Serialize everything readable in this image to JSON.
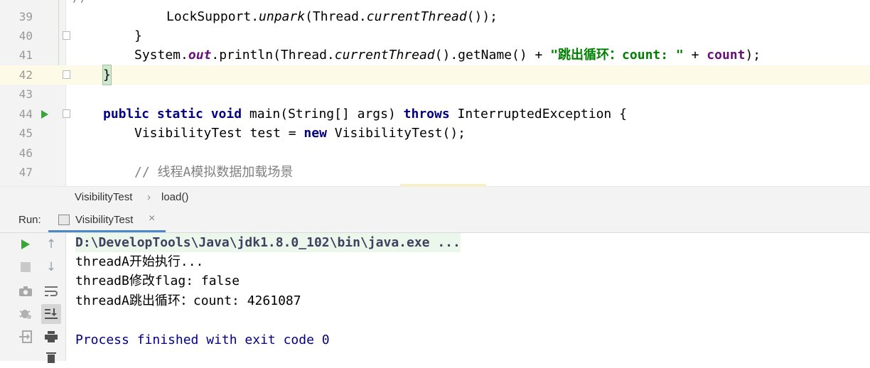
{
  "editor": {
    "lines": [
      {
        "num": "39",
        "segments": [
          {
            "t": "LockSupport.",
            "c": ""
          },
          {
            "t": "unpark",
            "c": "it"
          },
          {
            "t": "(Thread.",
            "c": ""
          },
          {
            "t": "currentThread",
            "c": "it"
          },
          {
            "t": "());",
            "c": ""
          }
        ]
      },
      {
        "num": "40",
        "segments": [
          {
            "t": "}",
            "c": ""
          }
        ]
      },
      {
        "num": "41",
        "segments": [
          {
            "t": "System.",
            "c": ""
          },
          {
            "t": "out",
            "c": "fld"
          },
          {
            "t": ".println(Thread.",
            "c": ""
          },
          {
            "t": "currentThread",
            "c": "it"
          },
          {
            "t": "().getName() + ",
            "c": ""
          },
          {
            "t": "\"跳出循环：count: \"",
            "c": "str"
          },
          {
            "t": " + ",
            "c": ""
          },
          {
            "t": "count",
            "c": "var"
          },
          {
            "t": ");",
            "c": ""
          }
        ]
      },
      {
        "num": "42",
        "segments": [
          {
            "t": "}",
            "c": ""
          }
        ]
      },
      {
        "num": "43",
        "segments": []
      },
      {
        "num": "44",
        "segments": [
          {
            "t": "public static void",
            "c": "kw"
          },
          {
            "t": " main(String[] args) ",
            "c": ""
          },
          {
            "t": "throws",
            "c": "kw"
          },
          {
            "t": " InterruptedException {",
            "c": ""
          }
        ]
      },
      {
        "num": "45",
        "segments": [
          {
            "t": "VisibilityTest test = ",
            "c": ""
          },
          {
            "t": "new",
            "c": "kw"
          },
          {
            "t": " VisibilityTest();",
            "c": ""
          }
        ]
      },
      {
        "num": "46",
        "segments": []
      },
      {
        "num": "47",
        "segments": [
          {
            "t": "// 线程A模拟数据加载场景",
            "c": "cmt"
          }
        ]
      }
    ]
  },
  "breadcrumb": {
    "class_name": "VisibilityTest",
    "separator": "›",
    "method": "load()"
  },
  "run_panel": {
    "label": "Run:",
    "tab_title": "VisibilityTest",
    "tab_close": "×"
  },
  "console": {
    "command": "D:\\DevelopTools\\Java\\jdk1.8.0_102\\bin\\java.exe ...",
    "output": [
      "threadA开始执行...",
      "threadB修改flag: false",
      "threadA跳出循环：count: 4261087"
    ],
    "exit_message": "Process finished with exit code 0"
  },
  "icons": [
    "run-icon",
    "stop-icon",
    "camera-icon",
    "debug-icon",
    "exit-icon",
    "up-arrow-icon",
    "down-arrow-icon",
    "soft-wrap-icon",
    "scroll-to-end-icon",
    "print-icon",
    "trash-icon"
  ],
  "colors": {
    "keyword": "#000080",
    "string": "#008000",
    "field": "#660e7a",
    "comment": "#808080",
    "current_line": "#fdfbe8",
    "run_green": "#3aa53a",
    "tab_underline": "#4a88c7"
  }
}
